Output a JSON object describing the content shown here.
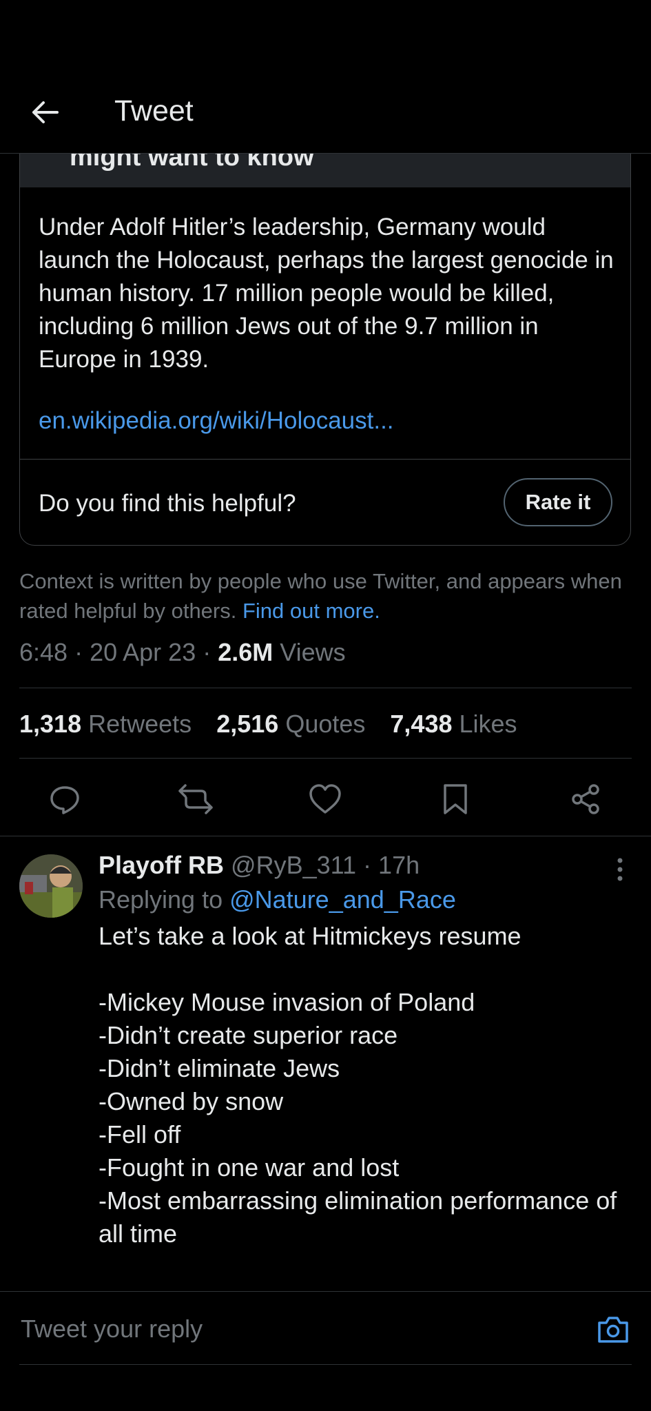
{
  "header": {
    "title": "Tweet",
    "back_icon": "arrow-left-icon"
  },
  "community_note": {
    "banner_text": "might want to know",
    "body": "Under Adolf Hitler’s leadership, Germany would launch the Holocaust, perhaps the largest genocide in human history. 17 million people would be killed, including 6 million Jews out of the 9.7 million in Europe in 1939.",
    "link": "en.wikipedia.org/wiki/Holocaust...",
    "helpful_question": "Do you find this helpful?",
    "rate_button": "Rate it"
  },
  "context": {
    "text": "Context is written by people who use Twitter, and appears when rated helpful by others. ",
    "link": "Find out more."
  },
  "meta": {
    "time": "6:48",
    "date": "20 Apr 23",
    "views_count": "2.6M",
    "views_label": "Views"
  },
  "stats": {
    "retweets_count": "1,318",
    "retweets_label": "Retweets",
    "quotes_count": "2,516",
    "quotes_label": "Quotes",
    "likes_count": "7,438",
    "likes_label": "Likes"
  },
  "actions": [
    "reply-icon",
    "retweet-icon",
    "like-icon",
    "bookmark-icon",
    "share-icon"
  ],
  "reply": {
    "name": "Playoff RB",
    "handle": "@RyB_311",
    "separator": "·",
    "time": "17h",
    "replying_prefix": "Replying to ",
    "replying_to": "@Nature_and_Race",
    "text": "Let’s take a look at Hitmickeys resume\n\n-Mickey Mouse invasion of Poland\n-Didn’t create superior race\n-Didn’t eliminate Jews\n-Owned by snow\n-Fell off\n-Fought in one war and lost\n-Most embarrassing elimination performance of all time"
  },
  "compose": {
    "placeholder": "Tweet your reply"
  },
  "colors": {
    "background": "#000000",
    "text": "#e7e9ea",
    "muted": "#71767b",
    "accent": "#4a99e9",
    "divider": "#2f3336"
  }
}
